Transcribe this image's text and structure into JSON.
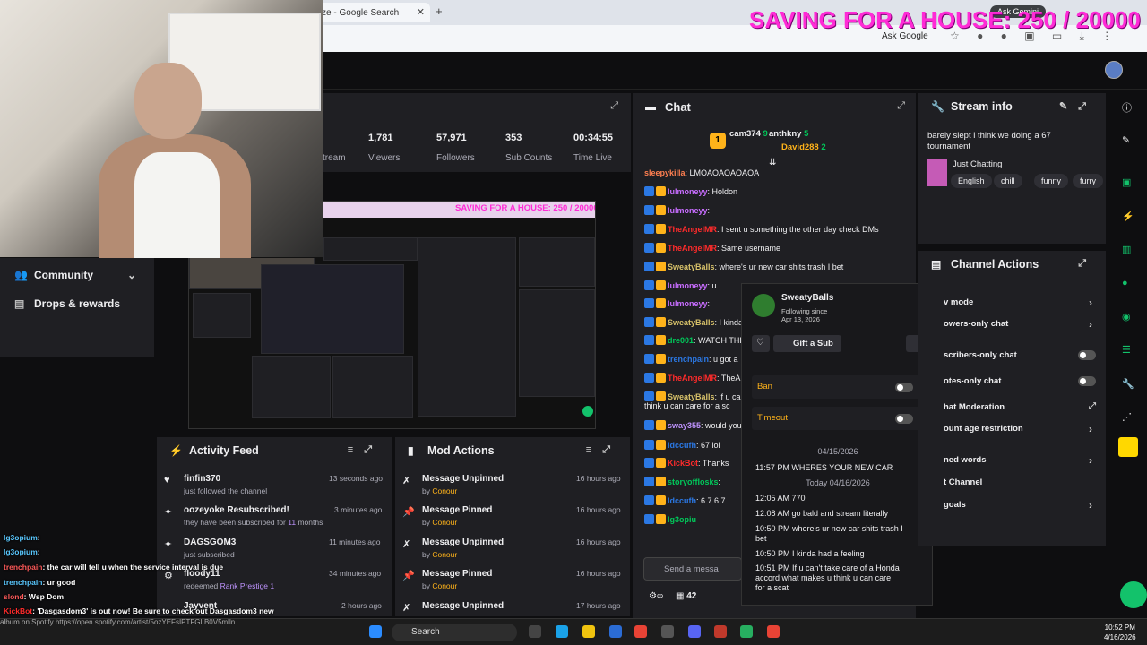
{
  "browser": {
    "tab_title": "ze - Google Search",
    "tab_close": "✕",
    "new_tab": "+",
    "ask_google": "Ask Google",
    "ask_gemini": "Ask Gemini"
  },
  "overlay_goal": "SAVING FOR A HOUSE: 250 / 20000",
  "sidebar": {
    "community": "Community",
    "drops": "Drops & rewards"
  },
  "stats": [
    {
      "value": "1,781",
      "label": "Viewers"
    },
    {
      "value": "57,971",
      "label": "Followers"
    },
    {
      "value": "353",
      "label": "Sub Counts"
    },
    {
      "value": "00:34:55",
      "label": "Time Live"
    }
  ],
  "stats_cut_label": "tream",
  "preview_goal": "SAVING FOR A HOUSE: 250 / 20000",
  "activity_feed": {
    "title": "Activity Feed",
    "items": [
      {
        "name": "finfin370",
        "desc": "just followed the channel",
        "time": "13 seconds ago"
      },
      {
        "name": "oozeyoke Resubscribed!",
        "desc_a": "they have been subscribed for ",
        "months": "11",
        "desc_b": " months",
        "time": "3 minutes ago"
      },
      {
        "name": "DAGSGOM3",
        "desc": "just subscribed",
        "time": "11 minutes ago"
      },
      {
        "name": "floody11",
        "desc_a": "redeemed ",
        "reward": "Rank Prestige 1",
        "time": "34 minutes ago"
      },
      {
        "name": "Jayvent",
        "time": "2 hours ago"
      }
    ]
  },
  "mod_actions": {
    "title": "Mod Actions",
    "items": [
      {
        "action": "Message Unpinned",
        "by_prefix": "by ",
        "by": "Conour",
        "time": "16 hours ago"
      },
      {
        "action": "Message Pinned",
        "by_prefix": "by ",
        "by": "Conour",
        "time": "16 hours ago"
      },
      {
        "action": "Message Unpinned",
        "by_prefix": "by ",
        "by": "Conour",
        "time": "16 hours ago"
      },
      {
        "action": "Message Pinned",
        "by_prefix": "by ",
        "by": "Conour",
        "time": "16 hours ago"
      },
      {
        "action": "Message Unpinned",
        "time": "17 hours ago"
      }
    ]
  },
  "chat": {
    "title": "Chat",
    "leaderboard": [
      {
        "name": "cam374",
        "count": "9"
      },
      {
        "name": "anthkny",
        "count": "5"
      },
      {
        "name": "David288",
        "count": "2"
      }
    ],
    "rank": "1",
    "messages": [
      {
        "user": "sleepykilla",
        "text": ": LMOAOAOAOAOA",
        "color": "#ff7f50"
      },
      {
        "user": "lulmoneyy",
        "text": ": Holdon",
        "color": "#c86dff"
      },
      {
        "user": "lulmoneyy",
        "text": ":",
        "color": "#c86dff"
      },
      {
        "user": "TheAngelMR",
        "text": ": I sent u something the other day check DMs",
        "color": "#ff2b2b"
      },
      {
        "user": "TheAngelMR",
        "text": ": Same username",
        "color": "#ff2b2b"
      },
      {
        "user": "SweatyBalls",
        "text": ": where's ur new car shits trash I bet",
        "color": "#d8c26a"
      },
      {
        "user": "lulmoneyy",
        "text": ": u",
        "color": "#c86dff"
      },
      {
        "user": "lulmoneyy",
        "text": ":",
        "color": "#c86dff"
      },
      {
        "user": "SweatyBalls",
        "text": ": I kinda ha",
        "color": "#d8c26a"
      },
      {
        "user": "dre001",
        "text": ": WATCH THE CA",
        "color": "#00c85a"
      },
      {
        "user": "trenchpain",
        "text": ": u got a",
        "color": "#2b78e4"
      },
      {
        "user": "TheAngelMR",
        "text": ": TheAnge",
        "color": "#ff2b2b"
      },
      {
        "user": "SweatyBalls",
        "text": ": if u can't t",
        "color": "#d8c26a"
      },
      {
        "user": "",
        "text": "think u can care for a sc",
        "color": "#efeff1"
      },
      {
        "user": "sway355",
        "text": ": would you bl",
        "color": "#bf94ff"
      },
      {
        "user": "ldccufh",
        "text": ": 67 lol",
        "color": "#2b78e4"
      },
      {
        "user": "KickBot",
        "text": ": Thanks",
        "color": "#ff2b2b"
      },
      {
        "user": "storyofflosks",
        "text": ":",
        "color": "#00c85a"
      },
      {
        "user": "ldccufh",
        "text": ": 6 7 6 7",
        "color": "#2b78e4"
      },
      {
        "user": "lg3opiu",
        "text": "",
        "color": "#00c85a"
      }
    ],
    "input_placeholder": "Send a messa",
    "footer_count": "42"
  },
  "user_card": {
    "name": "SweatyBalls",
    "following_label": "Following since",
    "following_date": "Apr 13, 2026",
    "gift_label": "Gift a Sub",
    "ban_label": "Ban",
    "timeout_label": "Timeout",
    "date1": "04/15/2026",
    "date2": "Today 04/16/2026",
    "logs": [
      {
        "text": "11:57 PM WHERES YOUR NEW CAR"
      },
      {
        "text": "12:05 AM 770"
      },
      {
        "text": "12:08 AM go bald and stream literally"
      },
      {
        "text": "10:50 PM where's ur new car shits trash I"
      },
      {
        "text": "bet"
      },
      {
        "text": "10:50 PM I kinda had a feeling"
      },
      {
        "text": "10:51 PM If u can't take care of a Honda"
      },
      {
        "text": "accord what makes u think u can care"
      },
      {
        "text": "for a scat"
      }
    ]
  },
  "stream_info": {
    "title": "Stream info",
    "description": "barely slept i think we doing a 67 tournament",
    "category": "Just Chatting",
    "tags": [
      "English",
      "chill",
      "funny",
      "furry"
    ]
  },
  "channel_actions": {
    "title": "Channel Actions",
    "rows": [
      {
        "label": "v mode",
        "control": "arrow"
      },
      {
        "label": "owers-only chat",
        "control": "arrow"
      },
      {
        "label": "scribers-only chat",
        "control": "toggle"
      },
      {
        "label": "otes-only chat",
        "control": "toggle"
      },
      {
        "label": "hat Moderation",
        "control": "link"
      },
      {
        "label": "ount age restriction",
        "control": "arrow"
      },
      {
        "label": "ned words",
        "control": "arrow"
      },
      {
        "label": "t Channel",
        "control": "none"
      },
      {
        "label": "goals",
        "control": "arrow"
      }
    ]
  },
  "stream_overlay_chat": [
    {
      "user": "lg3opium",
      "text": ":"
    },
    {
      "user": "lg3opium",
      "text": ":"
    },
    {
      "user": "trenchpain",
      "text": ": the car will tell u when the service interval is due"
    },
    {
      "user": "trenchpain",
      "text": ": ur good"
    },
    {
      "user": "slond",
      "text": ": Wsp Dom"
    },
    {
      "user": "KickBot",
      "text": ": 'Dasgasdom3' is out now! Be sure to check out Dasgasdom3 new"
    }
  ],
  "spotify_line": "album on Spotify https://open.spotify.com/artist/5ozYEFsIPTFGLB0V5mlln",
  "taskbar": {
    "search": "Search",
    "time": "10:52 PM",
    "date": "4/16/2026"
  }
}
